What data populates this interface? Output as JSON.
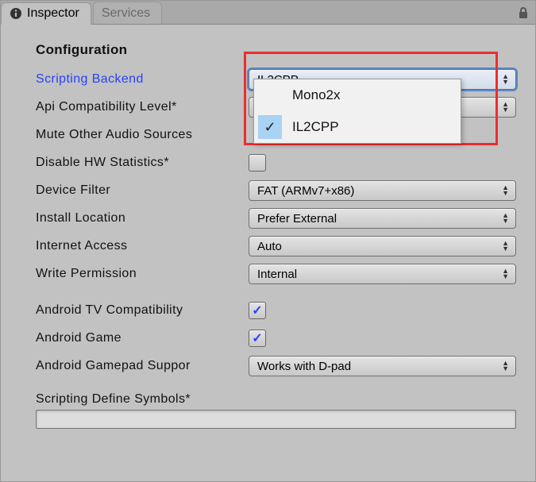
{
  "tabs": {
    "inspector": "Inspector",
    "services": "Services"
  },
  "section_title": "Configuration",
  "rows": {
    "scripting_backend": {
      "label": "Scripting Backend",
      "value": "IL2CPP"
    },
    "api_compat": {
      "label": "Api Compatibility Level*",
      "value": ""
    },
    "mute_audio": {
      "label": "Mute Other Audio Sources"
    },
    "disable_hw": {
      "label": "Disable HW Statistics*"
    },
    "device_filter": {
      "label": "Device Filter",
      "value": "FAT (ARMv7+x86)"
    },
    "install_location": {
      "label": "Install Location",
      "value": "Prefer External"
    },
    "internet_access": {
      "label": "Internet Access",
      "value": "Auto"
    },
    "write_permission": {
      "label": "Write Permission",
      "value": "Internal"
    },
    "android_tv": {
      "label": "Android TV Compatibility",
      "checked": true
    },
    "android_game": {
      "label": "Android Game",
      "checked": true
    },
    "gamepad_support": {
      "label": "Android Gamepad Suppor",
      "value": "Works with D-pad"
    },
    "define_symbols": {
      "label": "Scripting Define Symbols*"
    }
  },
  "popup": {
    "option1": "Mono2x",
    "option2": "IL2CPP"
  }
}
